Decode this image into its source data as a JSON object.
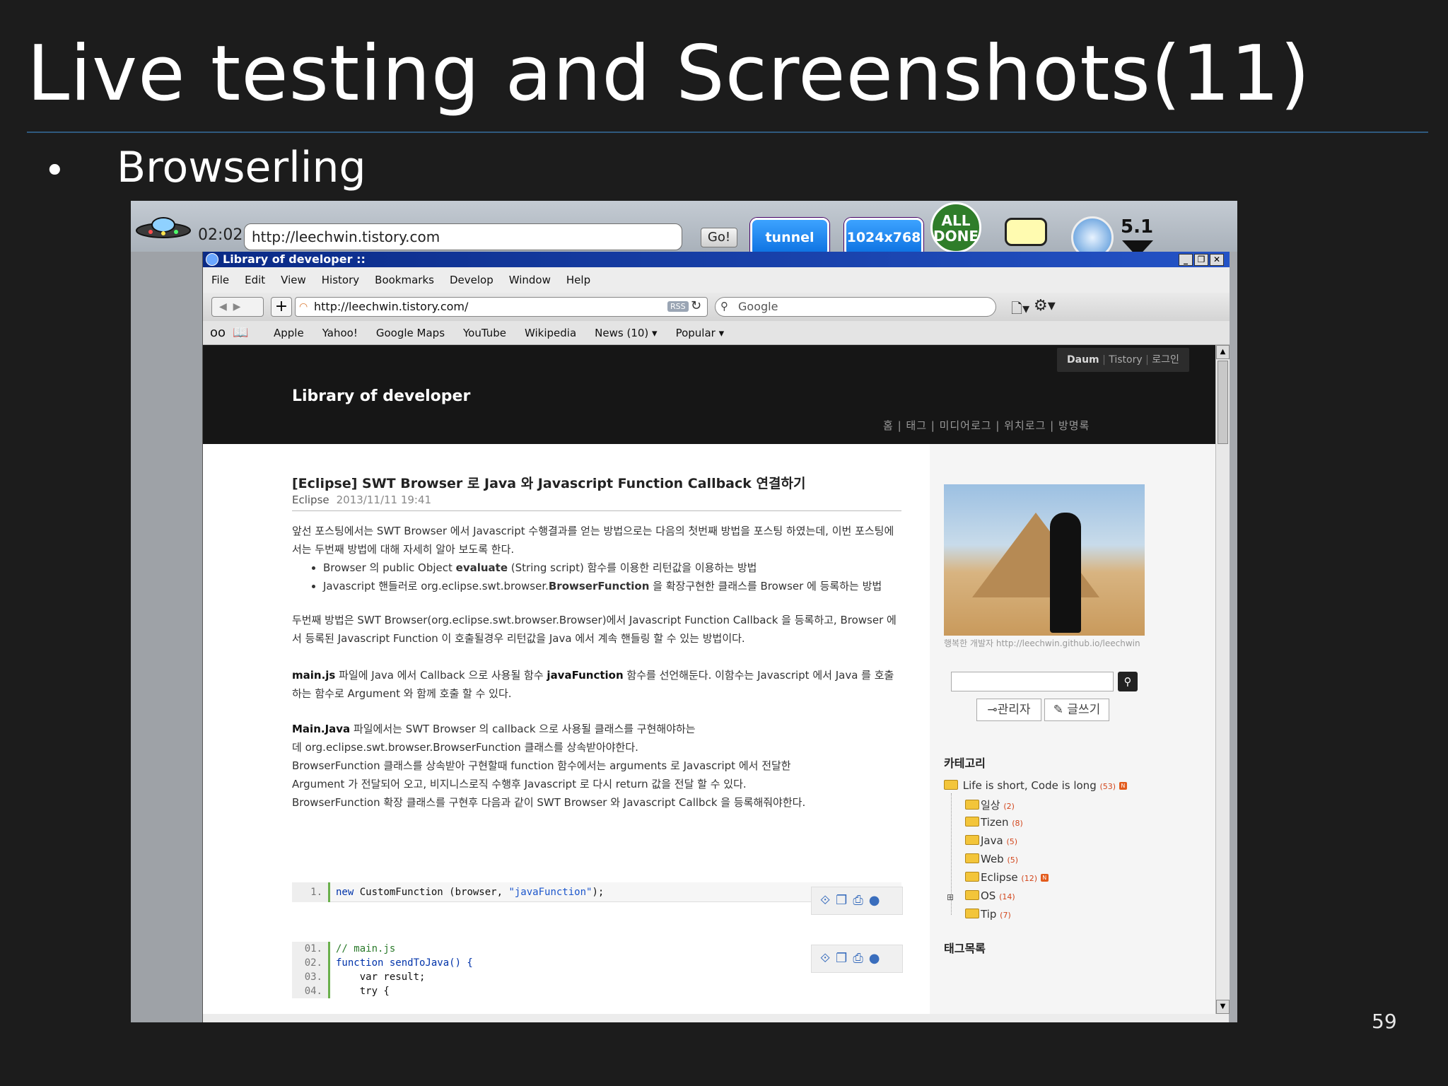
{
  "slide": {
    "title": "Live testing and Screenshots(11)",
    "bullet": "Browserling",
    "page_number": "59"
  },
  "browserling": {
    "clock": "02:02",
    "url": "http://leechwin.tistory.com",
    "go_label": "Go!",
    "tunnel_label": "tunnel",
    "resolution_label": "1024x768",
    "all_done_label": "ALL DONE",
    "browser_version": "5.1"
  },
  "window": {
    "title": "Library of developer ::",
    "menu": [
      "File",
      "Edit",
      "View",
      "History",
      "Bookmarks",
      "Develop",
      "Window",
      "Help"
    ],
    "address": "http://leechwin.tistory.com/",
    "rss_label": "RSS",
    "search_placeholder": "Google",
    "bookmarks": [
      "Apple",
      "Yahoo!",
      "Google Maps",
      "YouTube",
      "Wikipedia",
      "News (10) ▾",
      "Popular ▾"
    ]
  },
  "site": {
    "top_links": [
      "Daum",
      "Tistory",
      "로그인"
    ],
    "title": "Library of developer",
    "nav": "홈 | 태그 | 미디어로그 | 위치로그 | 방명록"
  },
  "post": {
    "title": "[Eclipse] SWT Browser 로 Java 와 Javascript Function Callback 연결하기",
    "category": "Eclipse",
    "date": "2013/11/11 19:41",
    "p1": "앞선 포스팅에서는 SWT Browser 에서 Javascript 수행결과를 얻는 방법으로는 다음의 첫번째 방법을 포스팅 하였는데, 이번 포스팅에서는 두번째 방법에 대해 자세히 알아 보도록 한다.",
    "li1_pre": "Browser 의 public Object ",
    "li1_bold": "evaluate",
    "li1_post": " (String script) 함수를 이용한 리턴값을 이용하는 방법",
    "li2_pre": "Javascript 핸들러로 org.eclipse.swt.browser.",
    "li2_bold": "BrowserFunction",
    "li2_post": " 을 확장구현한 클래스를 Browser 에 등록하는 방법",
    "p2": "두번째 방법은 SWT Browser(org.eclipse.swt.browser.Browser)에서 Javascript Function Callback 을 등록하고, Browser 에서 등록된 Javascript Function 이 호출될경우 리턴값을 Java 에서 계속 핸들링 할 수 있는 방법이다.",
    "p3_bold1": "main.js",
    "p3_mid": " 파일에 Java 에서 Callback 으로 사용될 함수 ",
    "p3_bold2": "javaFunction",
    "p3_post": " 함수를 선언해둔다. 이함수는 Javascript 에서 Java 를 호출하는 함수로 Argument 와 함께 호출 할 수 있다.",
    "p4_bold": "Main.Java",
    "p4_line1": " 파일에서는 SWT Browser 의 callback 으로 사용될 클래스를 구현해야하는",
    "p4_line2": "데 org.eclipse.swt.browser.BrowserFunction 클래스를 상속받아야한다.",
    "p4_line3": "BrowserFunction 클래스를 상속받아 구현할때 function 함수에서는 arguments 로 Javascript 에서 전달한",
    "p4_line4": "Argument 가 전달되어 오고, 비지니스로직 수행후 Javascript 로 다시 return 값을 전달 할 수 있다.",
    "p4_line5": "BrowserFunction 확장 클래스를 구현후 다음과 같이 SWT Browser 와 Javascript Callbck 을 등록해줘야한다.",
    "code1": {
      "num": "1.",
      "kw": "new",
      "text": " CustomFunction (browser, ",
      "str": "\"javaFunction\"",
      "end": ");"
    },
    "code2": [
      {
        "num": "01.",
        "text": "// main.js"
      },
      {
        "num": "02.",
        "text": "function sendToJava() {"
      },
      {
        "num": "03.",
        "text": "    var result;"
      },
      {
        "num": "04.",
        "text": "    try {"
      }
    ],
    "code_tools": "⟐❐⎙●"
  },
  "sidebar": {
    "photo_caption": "행복한 개발자 http://leechwin.github.io/leechwin",
    "admin_label": "⊸관리자",
    "write_label": "✎ 글쓰기",
    "category_heading": "카테고리",
    "category_root": "Life is short, Code is long",
    "category_root_count": "(53)",
    "categories": [
      {
        "name": "일상",
        "count": "(2)"
      },
      {
        "name": "Tizen",
        "count": "(8)"
      },
      {
        "name": "Java",
        "count": "(5)"
      },
      {
        "name": "Web",
        "count": "(5)"
      },
      {
        "name": "Eclipse",
        "count": "(12)"
      },
      {
        "name": "OS",
        "count": "(14)"
      },
      {
        "name": "Tip",
        "count": "(7)"
      }
    ],
    "tag_heading": "태그목록"
  }
}
